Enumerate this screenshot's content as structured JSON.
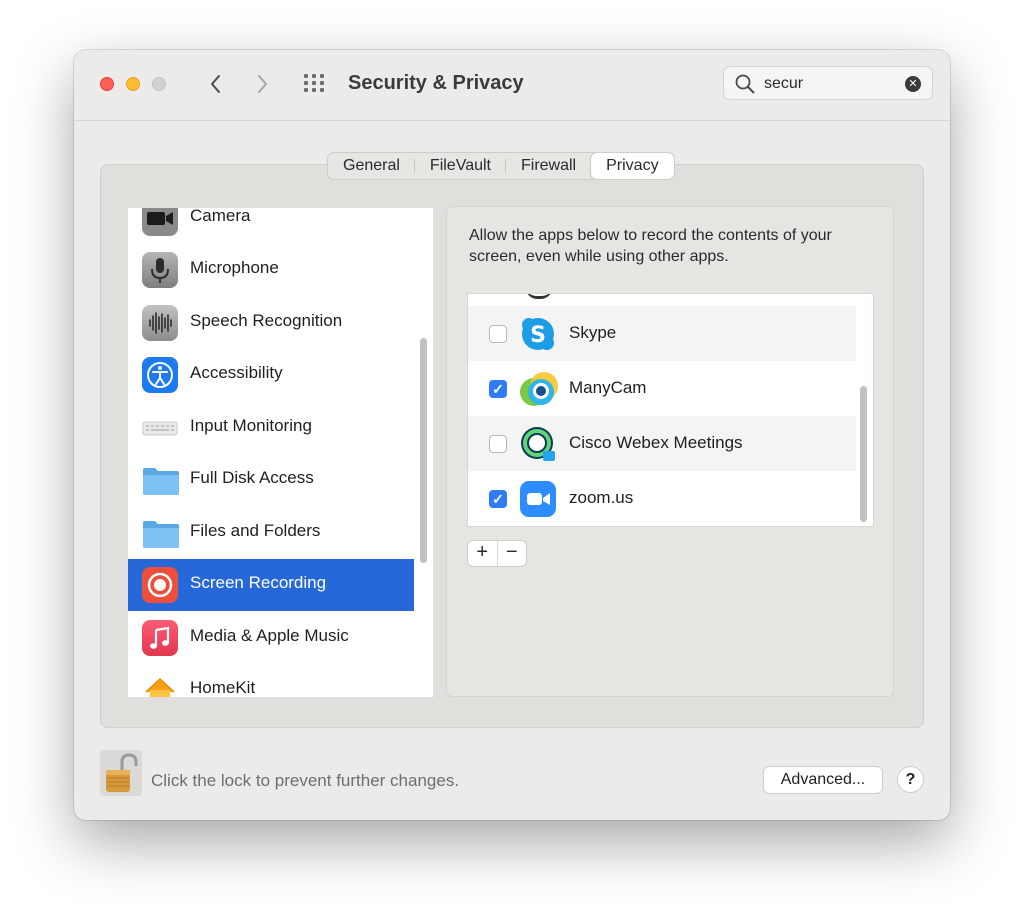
{
  "window": {
    "title": "Security & Privacy"
  },
  "search": {
    "value": "secur"
  },
  "tabs": [
    "General",
    "FileVault",
    "Firewall",
    "Privacy"
  ],
  "active_tab": "Privacy",
  "sidebar": {
    "items": [
      {
        "label": "Camera",
        "icon": "camera-icon"
      },
      {
        "label": "Microphone",
        "icon": "microphone-icon"
      },
      {
        "label": "Speech Recognition",
        "icon": "waveform-icon"
      },
      {
        "label": "Accessibility",
        "icon": "accessibility-icon"
      },
      {
        "label": "Input Monitoring",
        "icon": "keyboard-icon"
      },
      {
        "label": "Full Disk Access",
        "icon": "folder-icon"
      },
      {
        "label": "Files and Folders",
        "icon": "folder-icon"
      },
      {
        "label": "Screen Recording",
        "icon": "screen-recording-icon",
        "selected": true
      },
      {
        "label": "Media & Apple Music",
        "icon": "music-icon"
      },
      {
        "label": "HomeKit",
        "icon": "home-icon"
      }
    ]
  },
  "panel": {
    "description": "Allow the apps below to record the contents of your screen, even while using other apps.",
    "apps": [
      {
        "name": "Skype",
        "checked": false,
        "icon": "skype-icon"
      },
      {
        "name": "ManyCam",
        "checked": true,
        "icon": "manycam-icon"
      },
      {
        "name": "Cisco Webex Meetings",
        "checked": false,
        "icon": "webex-icon"
      },
      {
        "name": "zoom.us",
        "checked": true,
        "icon": "zoom-icon"
      }
    ],
    "add_label": "+",
    "remove_label": "−"
  },
  "footer": {
    "lock_text": "Click the lock to prevent further changes.",
    "advanced_label": "Advanced...",
    "help_label": "?"
  },
  "colors": {
    "selection": "#2768d9",
    "checkbox_on": "#2f7cf6",
    "close": "#fe5f57",
    "minimize": "#febc2e"
  }
}
